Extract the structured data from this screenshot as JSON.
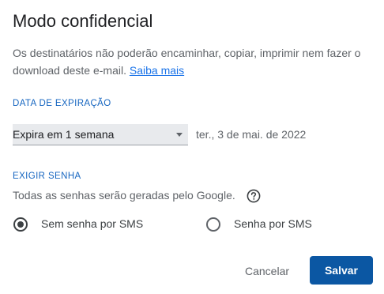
{
  "dialog": {
    "title": "Modo confidencial",
    "description": "Os destinatários não poderão encaminhar, copiar, imprimir nem fazer o download deste e-mail.",
    "learn_more": "Saiba mais"
  },
  "expiration": {
    "label": "DATA DE EXPIRAÇÃO",
    "selected": "Expira em 1 semana",
    "date_text": "ter., 3 de mai. de 2022"
  },
  "password": {
    "label": "EXIGIR SENHA",
    "description": "Todas as senhas serão geradas pelo Google.",
    "options": [
      {
        "label": "Sem senha por SMS",
        "checked": true
      },
      {
        "label": "Senha por SMS",
        "checked": false
      }
    ]
  },
  "actions": {
    "cancel": "Cancelar",
    "save": "Salvar"
  },
  "colors": {
    "accent": "#1a73e8",
    "primary_button": "#0b57a3",
    "section_label": "#1565c0"
  },
  "icons": {
    "help": "help-circle-icon",
    "dropdown": "dropdown-arrow-icon"
  }
}
